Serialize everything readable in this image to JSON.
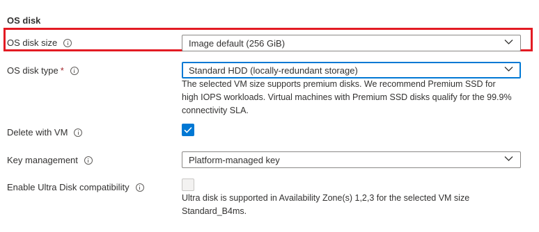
{
  "section": {
    "title": "OS disk"
  },
  "fields": {
    "os_disk_size": {
      "label": "OS disk size",
      "value": "Image default (256 GiB)"
    },
    "os_disk_type": {
      "label": "OS disk type",
      "required_marker": "*",
      "value": "Standard HDD (locally-redundant storage)",
      "help_lines": [
        "The selected VM size supports premium disks. We recommend Premium SSD for",
        "high IOPS workloads. Virtual machines with Premium SSD disks qualify for the 99.9%",
        "connectivity SLA."
      ]
    },
    "delete_with_vm": {
      "label": "Delete with VM",
      "checked": true
    },
    "key_management": {
      "label": "Key management",
      "value": "Platform-managed key"
    },
    "ultra_disk": {
      "label": "Enable Ultra Disk compatibility",
      "checked": false,
      "help_lines": [
        "Ultra disk is supported in Availability Zone(s) 1,2,3 for the selected VM size",
        "Standard_B4ms."
      ]
    }
  },
  "colors": {
    "accent": "#0078d4",
    "highlight_border": "#e31b23",
    "required": "#a4262c"
  }
}
